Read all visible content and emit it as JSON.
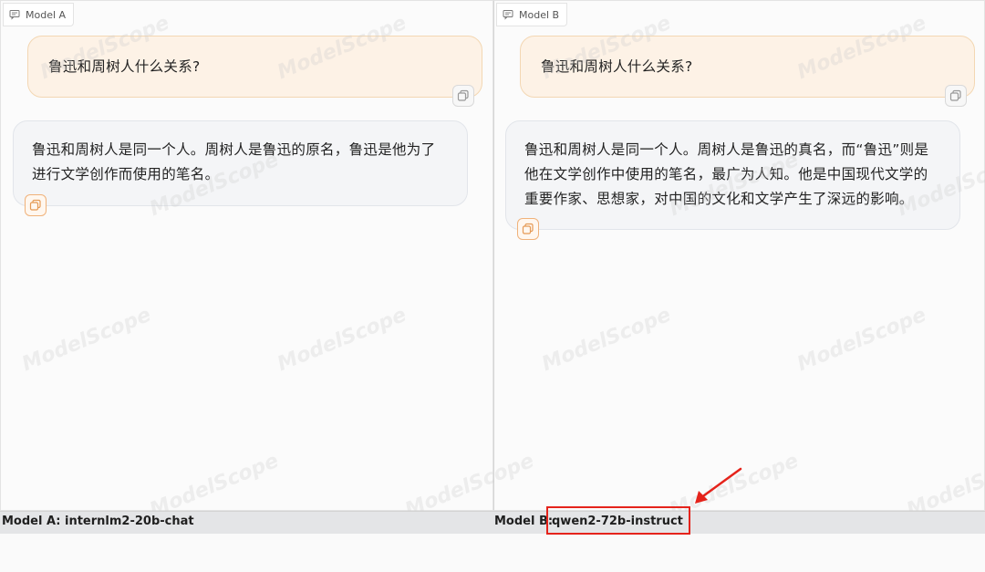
{
  "panels": {
    "a": {
      "label": "Model A",
      "user_message": "鲁迅和周树人什么关系?",
      "bot_message": "鲁迅和周树人是同一个人。周树人是鲁迅的原名，鲁迅是他为了进行文学创作而使用的笔名。"
    },
    "b": {
      "label": "Model B",
      "user_message": "鲁迅和周树人什么关系?",
      "bot_message": "鲁迅和周树人是同一个人。周树人是鲁迅的真名，而“鲁迅”则是他在文学创作中使用的笔名，最广为人知。他是中国现代文学的重要作家、思想家，对中国的文化和文学产生了深远的影响。"
    }
  },
  "footer": {
    "model_a": "Model A: internlm2-20b-chat",
    "model_b_prefix": "Model B:",
    "model_b_name": "qwen2-72b-instruct"
  },
  "watermark": "ModelScope",
  "icons": {
    "panel_label": "chat-icon",
    "copy": "copy-icon"
  },
  "colors": {
    "user_bubble": "#fdf2e6",
    "bot_bubble": "#f4f5f7",
    "accent": "#f0b27a",
    "highlight": "#e5231b"
  }
}
